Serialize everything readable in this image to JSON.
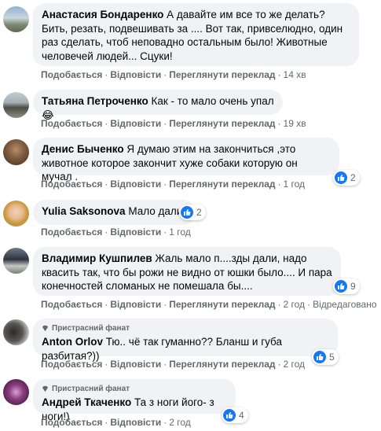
{
  "actions": {
    "like": "Подобається",
    "reply": "Відповісти",
    "translate": "Переглянути переклад",
    "edited": "Відредаговано",
    "separator": "·"
  },
  "fan_badge": "Пристрасний фанат",
  "colors": {
    "bubble": "#f0f2f5",
    "meta": "#65676b",
    "like": "#1877f2"
  },
  "comments": [
    {
      "author": "Анастасия Бондаренко",
      "text": "А давайте им все то же делать? Бить, резать, подвешивать за .... Вот так, привселюдно, один раз сделать, чтоб неповадно остальным было! Животные человечей людей... Сцуки!",
      "time": "14 хв"
    },
    {
      "author": "Татьяна Петроченко",
      "text": "Как - то мало очень упал",
      "emoji": "😂",
      "time": "19 хв"
    },
    {
      "author": "Денис Быченко",
      "text": "Я думаю этим на закончиться ,это животное которое закончит хуже собаки которую он мучал .",
      "time": "1 год",
      "reactions": "2"
    },
    {
      "author": "Yulia Saksonova",
      "text": "Мало дали!",
      "time": "1 год",
      "reactions": "2"
    },
    {
      "author": "Владимир Кушпилев",
      "text": "Жаль мало п....зды дали, надо квасить так, что бы рожи не видно от юшки было.... И пара конечностей сломаных не помешала бы....",
      "time": "2 год",
      "reactions": "9"
    },
    {
      "author": "Anton Orlov",
      "text": "Тю.. чё так гуманно?? Бланш и губа разбитая?))",
      "time": "2 год",
      "reactions": "5"
    },
    {
      "author": "Андрей Ткаченко",
      "text": "Та з ноги його- з ноги!)",
      "time": "2 год",
      "reactions": "4"
    }
  ]
}
